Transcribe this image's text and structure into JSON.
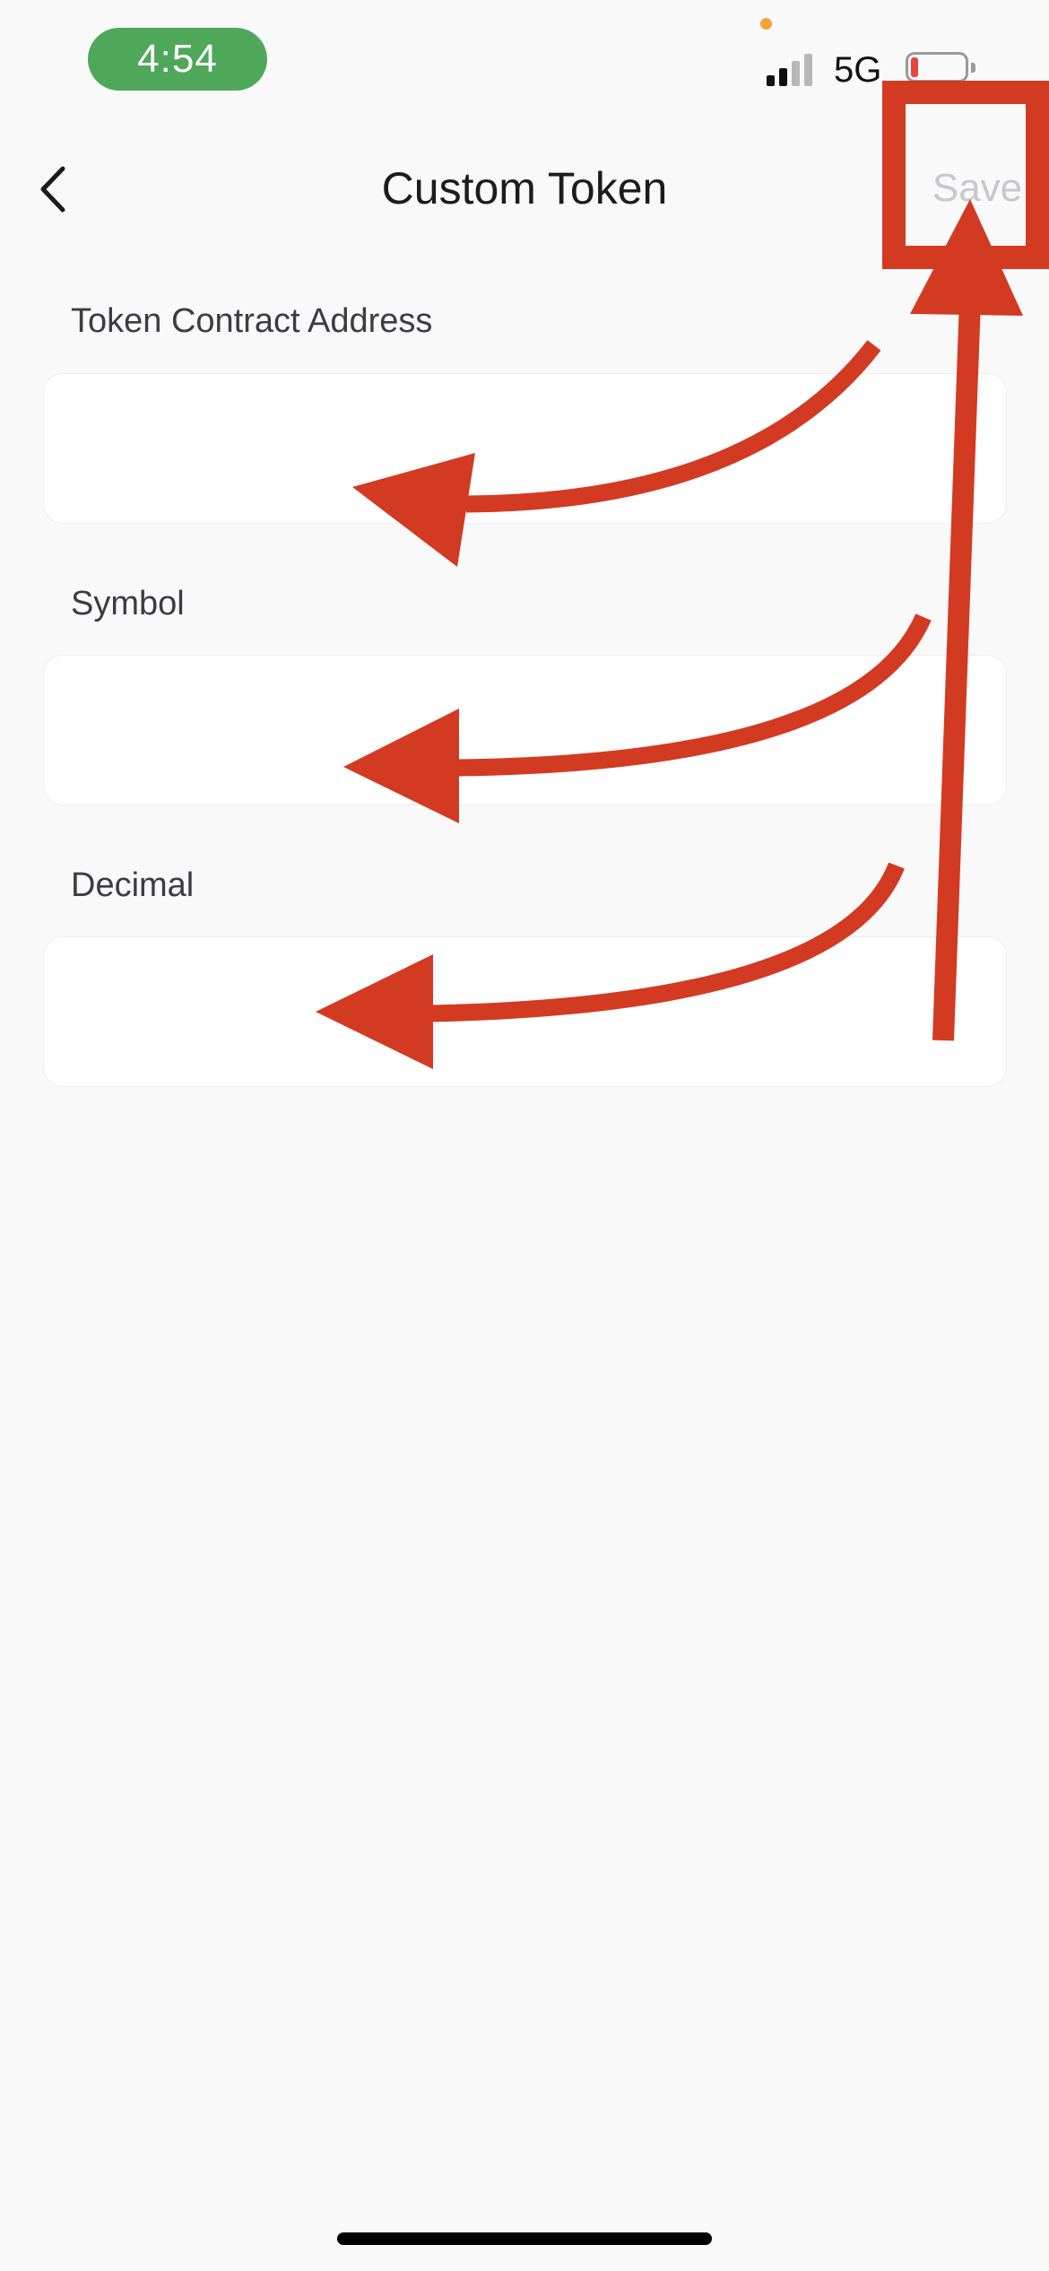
{
  "status_bar": {
    "time": "4:54",
    "network": "5G",
    "time_pill_color": "#4fa85a",
    "battery_level_color": "#e8453c",
    "privacy_dot_color": "#f2a43a"
  },
  "nav": {
    "title": "Custom Token",
    "save_label": "Save",
    "back_icon": "chevron-left-icon"
  },
  "form": {
    "fields": [
      {
        "label": "Token Contract Address",
        "value": "",
        "placeholder": ""
      },
      {
        "label": "Symbol",
        "value": "",
        "placeholder": ""
      },
      {
        "label": "Decimal",
        "value": "",
        "placeholder": ""
      }
    ]
  },
  "annotation": {
    "color": "#d33a22",
    "shapes": [
      "highlight-box",
      "arrow",
      "arrow",
      "arrow",
      "arrow"
    ]
  }
}
